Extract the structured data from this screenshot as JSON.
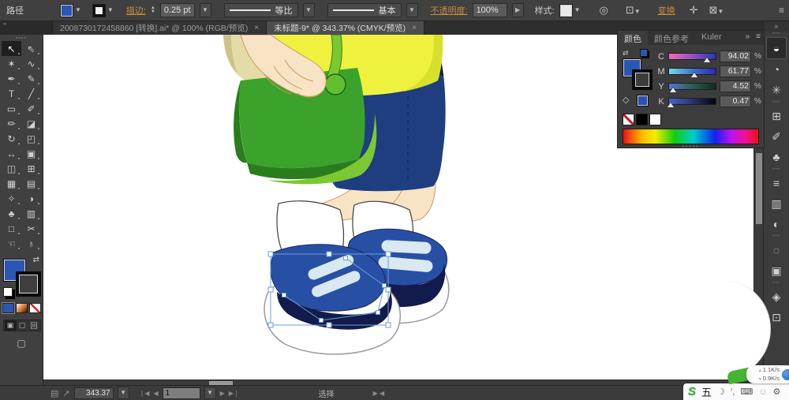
{
  "app": {
    "context_label": "路径"
  },
  "control_bar": {
    "stroke_label": "描边:",
    "stroke_value": "0.25 pt",
    "profile_value": "等比",
    "brush_value": "基本",
    "opacity_label": "不透明度:",
    "opacity_value": "100%",
    "style_label": "样式:",
    "transform_label": "变换"
  },
  "icons": {
    "doc_setup": "◎",
    "select_similar": "⊡",
    "expand": "✛",
    "constrain": "⊠",
    "panel_menu": "≡",
    "collapse": "»",
    "grip": "•••",
    "swap": "⇄",
    "cube": "◇",
    "nav_first": "❘◀",
    "nav_prev": "◀",
    "nav_next": "▶",
    "nav_last": "▶❘",
    "workspace": "▤",
    "share": "↗",
    "pair_left": "◀",
    "pair_right": "▶",
    "screen_mode": "▢",
    "draw_normal": "▣",
    "draw_behind": "▢",
    "draw_inside": "回"
  },
  "tabs": [
    {
      "title": "2008730172458860 [转换].ai* @ 100% (RGB/预览)",
      "close": "×"
    },
    {
      "title": "未标题-9* @ 343.37% (CMYK/预览)",
      "close": "×"
    }
  ],
  "tools": [
    {
      "name": "selection",
      "glyph": "↖"
    },
    {
      "name": "direct-selection",
      "glyph": "⇖"
    },
    {
      "name": "magic-wand",
      "glyph": "✶"
    },
    {
      "name": "lasso",
      "glyph": "∿"
    },
    {
      "name": "pen",
      "glyph": "✒"
    },
    {
      "name": "ink-pen",
      "glyph": "✎"
    },
    {
      "name": "type",
      "glyph": "T"
    },
    {
      "name": "line-segment",
      "glyph": "╱"
    },
    {
      "name": "rectangle",
      "glyph": "▭"
    },
    {
      "name": "paintbrush",
      "glyph": "✐"
    },
    {
      "name": "pencil",
      "glyph": "✏"
    },
    {
      "name": "eraser",
      "glyph": "◪"
    },
    {
      "name": "rotate",
      "glyph": "↻"
    },
    {
      "name": "scale",
      "glyph": "◰"
    },
    {
      "name": "width",
      "glyph": "↔"
    },
    {
      "name": "free-transform",
      "glyph": "▣"
    },
    {
      "name": "shape-builder",
      "glyph": "◫"
    },
    {
      "name": "perspective-grid",
      "glyph": "⊞"
    },
    {
      "name": "mesh",
      "glyph": "▦"
    },
    {
      "name": "gradient",
      "glyph": "▤"
    },
    {
      "name": "eyedropper",
      "glyph": "✧"
    },
    {
      "name": "blend",
      "glyph": "◑"
    },
    {
      "name": "symbol-sprayer",
      "glyph": "♣"
    },
    {
      "name": "column-graph",
      "glyph": "▥"
    },
    {
      "name": "artboard",
      "glyph": "□"
    },
    {
      "name": "slice",
      "glyph": "✂"
    },
    {
      "name": "hand",
      "glyph": "☜"
    },
    {
      "name": "zoom",
      "glyph": "♁"
    }
  ],
  "color_panel": {
    "tabs": [
      "颜色",
      "颜色参考",
      "Kuler"
    ],
    "sliders": [
      {
        "label": "C",
        "value": "94.02"
      },
      {
        "label": "M",
        "value": "61.77"
      },
      {
        "label": "Y",
        "value": "4.52"
      },
      {
        "label": "K",
        "value": "0.47"
      }
    ],
    "percent": "%"
  },
  "dock": [
    {
      "name": "color",
      "glyph": "◒"
    },
    {
      "name": "color-guide",
      "glyph": "◔"
    },
    {
      "name": "kuler",
      "glyph": "✳"
    },
    {
      "name": "swatches",
      "glyph": "⊞"
    },
    {
      "name": "brushes",
      "glyph": "✐"
    },
    {
      "name": "symbols",
      "glyph": "♣"
    },
    {
      "name": "stroke",
      "glyph": "≡"
    },
    {
      "name": "gradient",
      "glyph": "▥"
    },
    {
      "name": "transparency",
      "glyph": "◐"
    },
    {
      "name": "appearance",
      "glyph": "◌"
    },
    {
      "name": "graphic-styles",
      "glyph": "▣"
    },
    {
      "name": "layers",
      "glyph": "◈"
    },
    {
      "name": "artboards",
      "glyph": "⊡"
    }
  ],
  "status_bar": {
    "zoom": "343.37",
    "artboard": "1",
    "mode": "选择"
  },
  "ime": {
    "logo": "S",
    "wubi": "五",
    "moon": "☽",
    "punct": "’,",
    "keyboard": "⌨",
    "person": "☺",
    "wrench": "⚙"
  },
  "net": {
    "up": "1.1K/s",
    "down": "0.9K/s",
    "up_icon": "▴",
    "down_icon": "▾"
  },
  "palette": {
    "accent_orange": "#c98a3d",
    "fill_blue": "#2b57b4",
    "shirt_yellow": "#eef23e",
    "shirt_shade": "#d9e02c",
    "sleeve_khaki": "#e4dca6",
    "sleeve_shadow": "#cdc388",
    "skin": "#f8e3c5",
    "skin_outline": "#c89a66",
    "bag_green": "#3ba32b",
    "bag_dark": "#2a7d1d",
    "bag_light": "#7cc832",
    "shorts_navy": "#1e3e80",
    "shorts_dark": "#0e1a46",
    "shoe_blue": "#2750a5",
    "shoe_dark": "#121b4c",
    "strap_pale": "#d9e8f1",
    "sole_outline": "#9b9b9b",
    "selection_blue": "#6f9bd6"
  }
}
